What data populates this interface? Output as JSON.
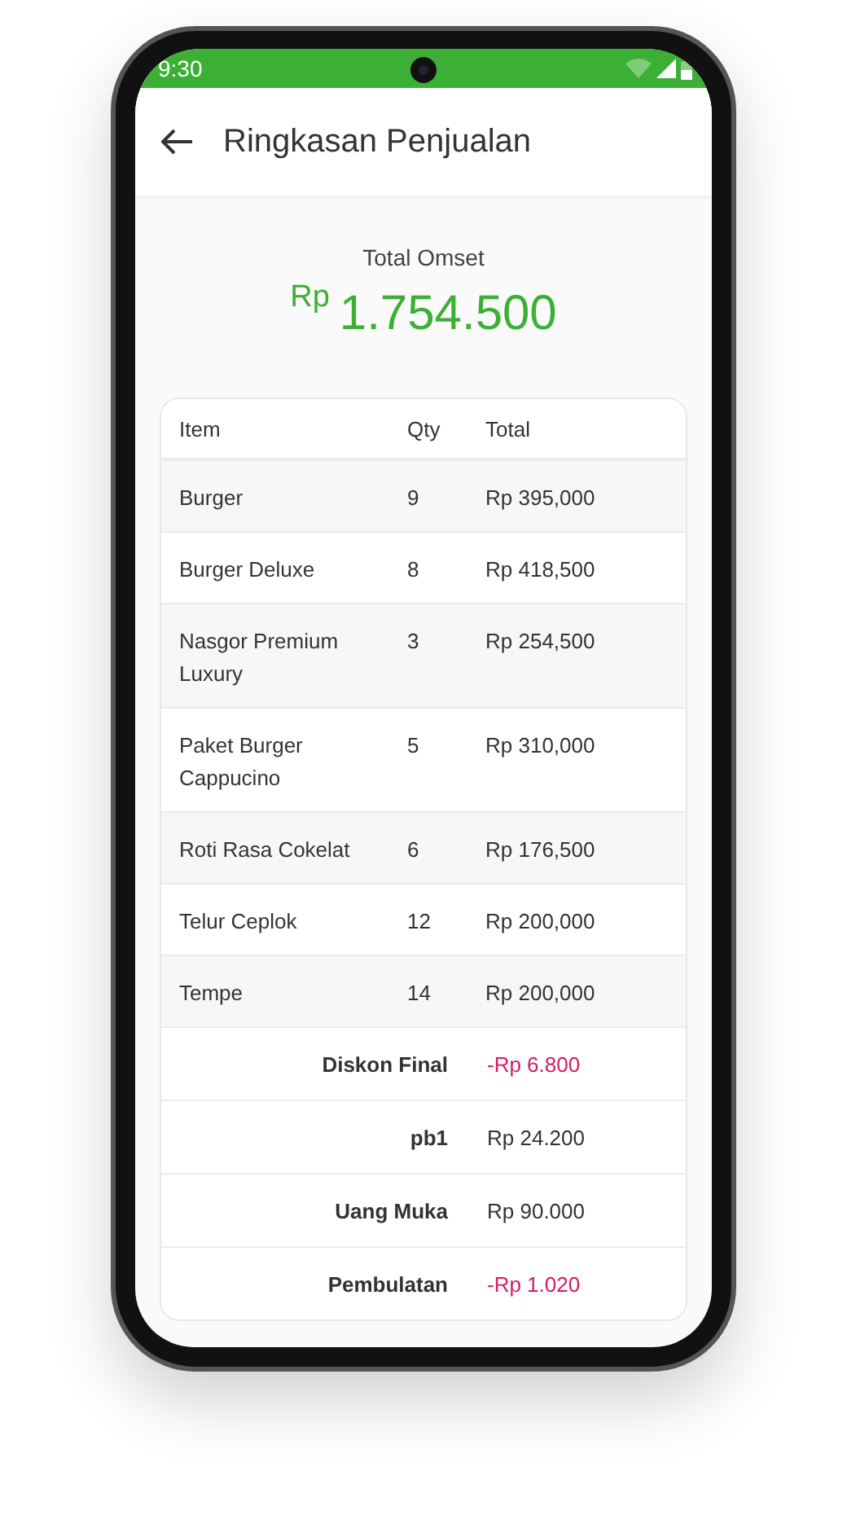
{
  "status_bar": {
    "time": "9:30"
  },
  "app_bar": {
    "title": "Ringkasan Penjualan"
  },
  "summary": {
    "label": "Total Omset",
    "currency": "Rp",
    "amount": "1.754.500"
  },
  "table": {
    "columns": [
      "Item",
      "Qty",
      "Total"
    ],
    "rows": [
      {
        "item": "Burger",
        "qty": "9",
        "total": "Rp 395,000"
      },
      {
        "item": "Burger Deluxe",
        "qty": "8",
        "total": "Rp 418,500"
      },
      {
        "item": "Nasgor Premium Luxury",
        "qty": "3",
        "total": "Rp 254,500"
      },
      {
        "item": "Paket Burger Cappucino",
        "qty": "5",
        "total": "Rp 310,000"
      },
      {
        "item": "Roti Rasa Cokelat",
        "qty": "6",
        "total": "Rp 176,500"
      },
      {
        "item": "Telur Ceplok",
        "qty": "12",
        "total": "Rp 200,000"
      },
      {
        "item": "Tempe",
        "qty": "14",
        "total": "Rp 200,000"
      }
    ],
    "adjustments": [
      {
        "label": "Diskon Final",
        "value": "-Rp 6.800",
        "color": "#d81b60"
      },
      {
        "label": "pb1",
        "value": "Rp 24.200",
        "color": "#333333"
      },
      {
        "label": "Uang Muka",
        "value": "Rp 90.000",
        "color": "#333333"
      },
      {
        "label": "Pembulatan",
        "value": "-Rp 1.020",
        "color": "#d81b60"
      }
    ]
  }
}
